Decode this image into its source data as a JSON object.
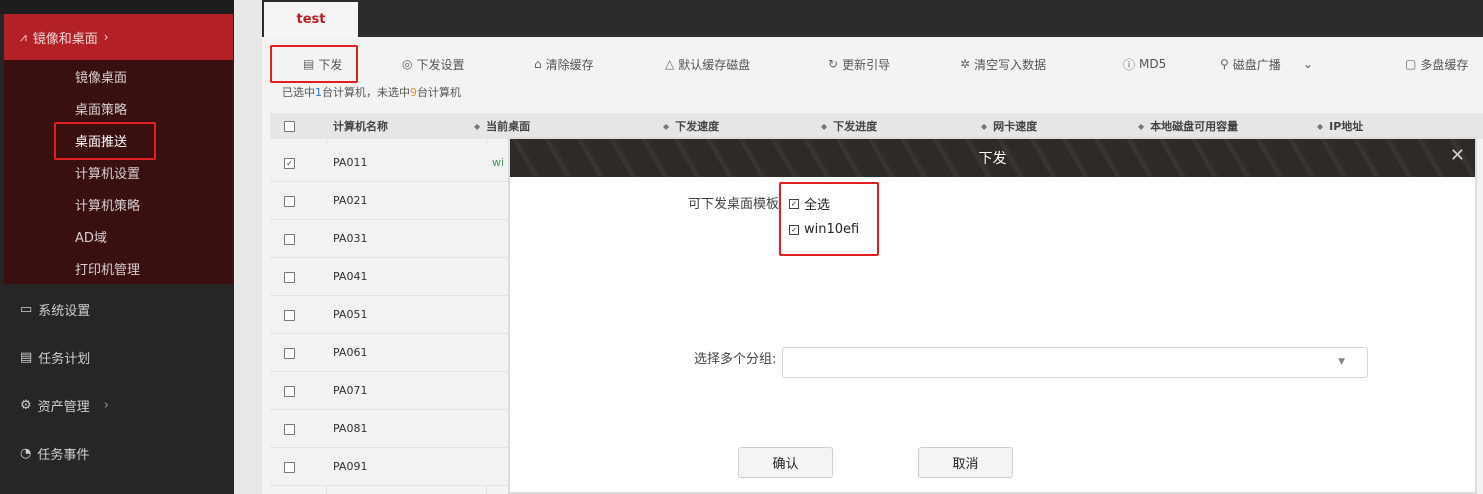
{
  "sidebar": {
    "group_label": "镜像和桌面",
    "sub_items": [
      {
        "label": "镜像桌面"
      },
      {
        "label": "桌面策略"
      },
      {
        "label": "桌面推送"
      },
      {
        "label": "计算机设置"
      },
      {
        "label": "计算机策略"
      },
      {
        "label": "AD域"
      },
      {
        "label": "打印机管理"
      }
    ],
    "menu_items": [
      {
        "label": "系统设置",
        "icon": "monitor-icon"
      },
      {
        "label": "任务计划",
        "icon": "calendar-icon"
      },
      {
        "label": "资产管理",
        "icon": "gear-icon"
      },
      {
        "label": "任务事件",
        "icon": "clock-icon"
      }
    ]
  },
  "tabs": [
    {
      "label": "test"
    }
  ],
  "toolbar": {
    "buttons": [
      {
        "label": "下发",
        "icon": "push-icon"
      },
      {
        "label": "下发设置",
        "icon": "settings-icon"
      },
      {
        "label": "清除缓存",
        "icon": "broom-icon"
      },
      {
        "label": "默认缓存磁盘",
        "icon": "disk-icon"
      },
      {
        "label": "更新引导",
        "icon": "refresh-icon"
      },
      {
        "label": "清空写入数据",
        "icon": "sparkle-icon"
      },
      {
        "label": "MD5",
        "icon": "info-icon"
      },
      {
        "label": "磁盘广播",
        "icon": "broadcast-icon"
      },
      {
        "label": "多盘缓存",
        "icon": "checkbox-icon"
      }
    ]
  },
  "selection": {
    "prefix": "已选中",
    "selected": "1",
    "mid": "台计算机，未选中",
    "unselected": "9",
    "suffix": "台计算机"
  },
  "table": {
    "headers": [
      "计算机名称",
      "当前桌面",
      "下发速度",
      "下发进度",
      "网卡速度",
      "本地磁盘可用容量",
      "IP地址"
    ],
    "rows": [
      {
        "name": "PA011",
        "current": "wi",
        "checked": true
      },
      {
        "name": "PA021",
        "current": "",
        "checked": false
      },
      {
        "name": "PA031",
        "current": "",
        "checked": false
      },
      {
        "name": "PA041",
        "current": "",
        "checked": false
      },
      {
        "name": "PA051",
        "current": "",
        "checked": false
      },
      {
        "name": "PA061",
        "current": "",
        "checked": false
      },
      {
        "name": "PA071",
        "current": "",
        "checked": false
      },
      {
        "name": "PA081",
        "current": "",
        "checked": false
      },
      {
        "name": "PA091",
        "current": "",
        "checked": false
      }
    ]
  },
  "dialog": {
    "title": "下发",
    "template_label": "可下发桌面模板",
    "options": [
      {
        "label": "全选",
        "checked": true
      },
      {
        "label": "win10efi",
        "checked": true
      }
    ],
    "group_label": "选择多个分组:",
    "group_value": "",
    "confirm_label": "确认",
    "cancel_label": "取消",
    "close_glyph": "✕"
  },
  "colors": {
    "accent": "#b32025",
    "highlight": "#e02020"
  }
}
